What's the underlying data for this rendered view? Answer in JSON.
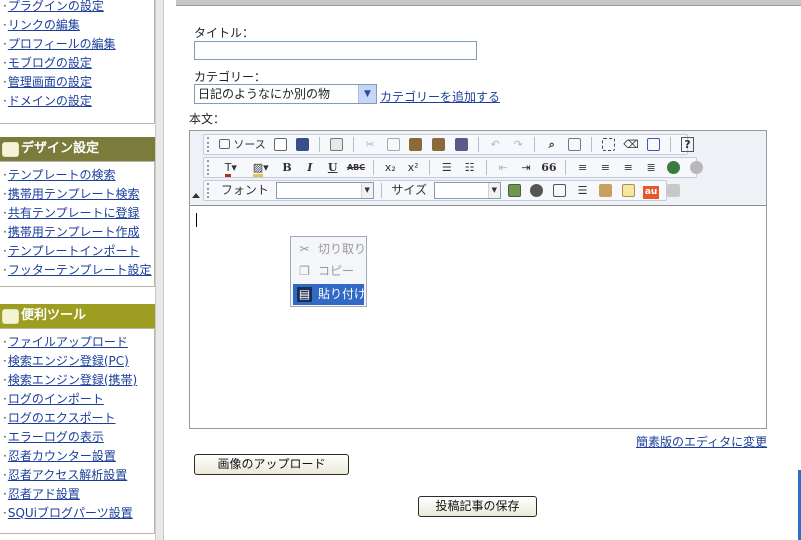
{
  "sidebar": {
    "top_items": [
      "プラグインの設定",
      "リンクの編集",
      "プロフィールの編集",
      "モブログの設定",
      "管理画面の設定",
      "ドメインの設定"
    ],
    "design_section": {
      "title": "デザイン設定",
      "items": [
        "テンプレートの検索",
        "携帯用テンプレート検索",
        "共有テンプレートに登録",
        "携帯用テンプレート作成",
        "テンプレートインポート",
        "フッターテンプレート設定"
      ]
    },
    "tools_section": {
      "title": "便利ツール",
      "items": [
        "ファイルアップロード",
        "検索エンジン登録(PC)",
        "検索エンジン登録(携帯)",
        "ログのインポート",
        "ログのエクスポート",
        "エラーログの表示",
        "忍者カウンター設置",
        "忍者アクセス解析設置",
        "忍者アド設置",
        "SQUiブログパーツ設置"
      ]
    }
  },
  "form": {
    "title_label": "タイトル：",
    "title_value": "",
    "category_label": "カテゴリー：",
    "category_selected": "日記のようなにか別の物",
    "add_category_link": "カテゴリーを追加する",
    "body_label": "本文："
  },
  "editor": {
    "source_label": "ソース",
    "font_label": "フォント",
    "size_label": "サイズ",
    "bold": "B",
    "italic": "I",
    "underline": "U",
    "strike": "ABC",
    "subscript": "x₂",
    "superscript": "x²",
    "quote": "66",
    "au_badge": "au"
  },
  "context_menu": {
    "cut": "切り取り",
    "copy": "コピー",
    "paste": "貼り付け"
  },
  "simple_editor_link": "簡素版のエディタに変更",
  "upload_image_button": "画像のアップロード",
  "save_post_button": "投稿記事の保存",
  "colors": {
    "design_header": "#7b7b3b",
    "tools_header": "#9d9d22",
    "link": "#1b3f9b",
    "menu_highlight": "#316ac5"
  }
}
